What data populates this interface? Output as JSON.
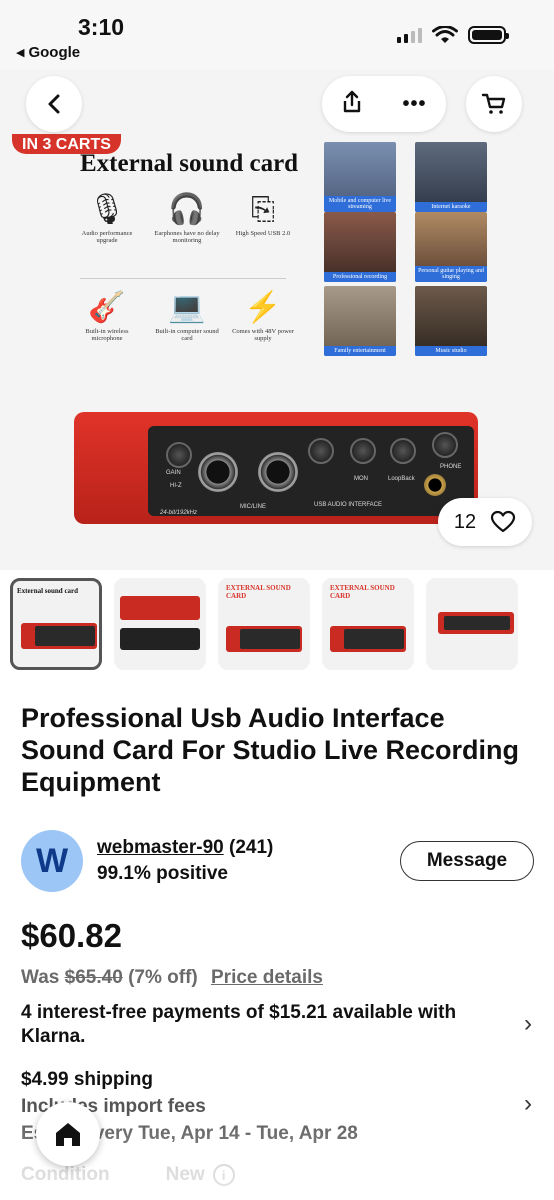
{
  "status_bar": {
    "time": "3:10",
    "back_app": "Google"
  },
  "hero": {
    "carts_badge": "IN 3 CARTS",
    "promo_title": "External sound card",
    "features": [
      {
        "icon": "microphone-icon",
        "label": "Audio performance upgrade"
      },
      {
        "icon": "headphones-icon",
        "label": "Earphones have no delay monitoring"
      },
      {
        "icon": "usb-icon",
        "label": "High Speed USB 2.0"
      },
      {
        "icon": "guitar-mic-icon",
        "label": "Built-in wireless microphone"
      },
      {
        "icon": "laptop-icon",
        "label": "Built-in computer sound card"
      },
      {
        "icon": "lightning-icon",
        "label": "Comes with 48V power supply"
      }
    ],
    "photos": [
      {
        "caption": "Mobile and computer live streaming"
      },
      {
        "caption": "Internet karaoke"
      },
      {
        "caption": "Professional recording"
      },
      {
        "caption": "Personal guitar playing and singing"
      },
      {
        "caption": "Family entertainment"
      },
      {
        "caption": "Music studio"
      }
    ],
    "device_labels": {
      "gain": "GAIN",
      "hiz": "HI-Z",
      "mic_line": "MIC/LINE",
      "usb": "USB AUDIO INTERFACE",
      "phone": "PHONE",
      "mon": "MON",
      "loopback": "LoopBack",
      "spec": "24-bit/192kHz"
    },
    "like_count": "12"
  },
  "thumbnails": [
    {
      "label": "External sound card",
      "selected": true
    },
    {
      "label": "",
      "selected": false
    },
    {
      "label": "EXTERNAL SOUND CARD",
      "selected": false
    },
    {
      "label": "EXTERNAL SOUND CARD",
      "selected": false
    },
    {
      "label": "",
      "selected": false
    }
  ],
  "product": {
    "title": "Professional Usb Audio Interface Sound Card For Studio Live Recording Equipment",
    "seller": {
      "initial": "W",
      "name": "webmaster-90",
      "feedback_count": "(241)",
      "positive": "99.1% positive",
      "message_label": "Message"
    },
    "price": "$60.82",
    "was_label": "Was",
    "was_price": "$65.40",
    "discount": "(7% off)",
    "price_details": "Price details",
    "klarna_text": "4 interest-free payments of $15.21 available with Klarna.",
    "shipping": "$4.99 shipping",
    "import_fees": "Includes import fees",
    "delivery": "Est. delivery Tue, Apr 14 - Tue, Apr 28",
    "condition_label": "Condition",
    "condition_value": "New"
  },
  "colors": {
    "device_red": "#d12c22",
    "badge_red": "#d6342a",
    "avatar_blue": "#9cc6f5",
    "caption_blue": "#2f6ed8"
  }
}
